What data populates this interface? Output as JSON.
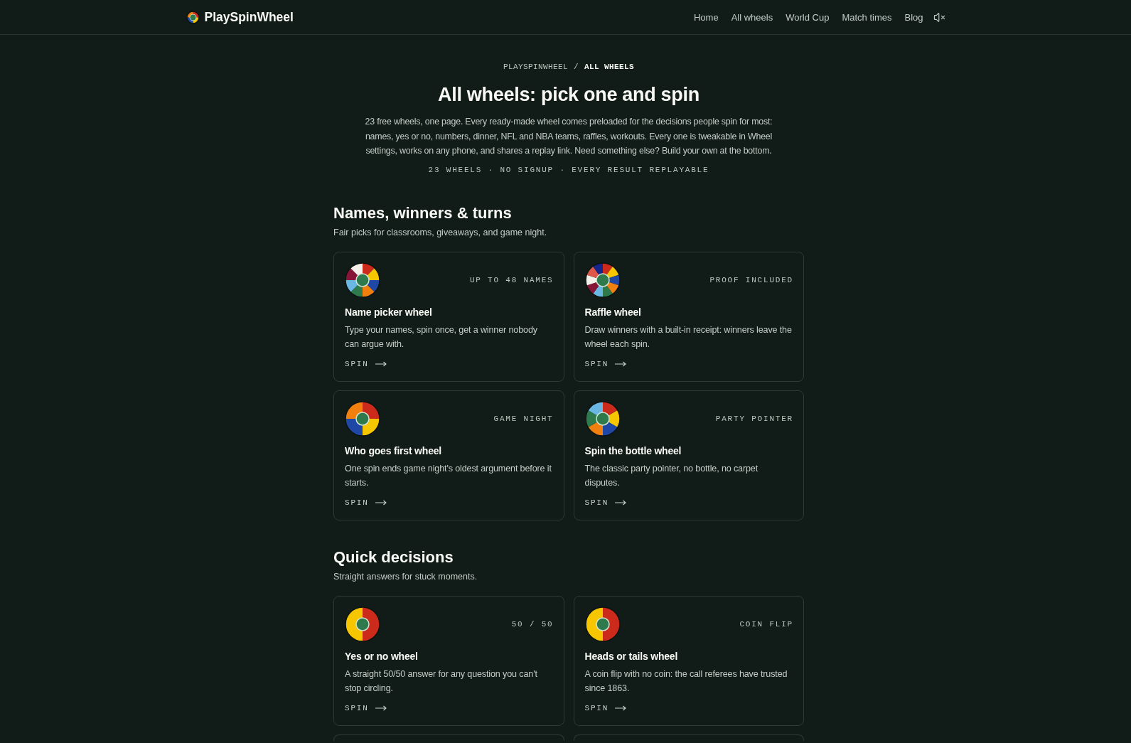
{
  "header": {
    "logo": "PlaySpinWheel",
    "nav": [
      "Home",
      "All wheels",
      "World Cup",
      "Match times",
      "Blog"
    ],
    "sound": {
      "muted": true
    }
  },
  "breadcrumb": {
    "separator": "/",
    "items": [
      {
        "label": "PLAYSPINWHEEL",
        "current": false
      },
      {
        "label": "ALL WHEELS",
        "current": true
      }
    ]
  },
  "title": "All wheels: pick one and spin",
  "intro": "23 free wheels, one page. Every ready-made wheel comes preloaded for the decisions people spin for most: names, yes or no, numbers, dinner, NFL and NBA teams, raffles, workouts. Every one is tweakable in Wheel settings, works on any phone, and shares a replay link. Need something else? Build your own at the bottom.",
  "tagline": "23 WHEELS · NO SIGNUP · EVERY RESULT REPLAYABLE",
  "sections": [
    {
      "heading": "Names, winners & turns",
      "subheading": "Fair picks for classrooms, giveaways, and game night.",
      "cards": [
        {
          "kind": "eight",
          "tag": "UP TO 48 NAMES",
          "title": "Name picker wheel",
          "description": "Type your names, spin once, get a winner nobody can argue with.",
          "action": "SPIN"
        },
        {
          "kind": "ten",
          "tag": "PROOF INCLUDED",
          "title": "Raffle wheel",
          "description": "Draw winners with a built-in receipt: winners leave the wheel each spin.",
          "action": "SPIN"
        },
        {
          "kind": "four",
          "tag": "GAME NIGHT",
          "title": "Who goes first wheel",
          "description": "One spin ends game night's oldest argument before it starts.",
          "action": "SPIN"
        },
        {
          "kind": "six",
          "tag": "PARTY POINTER",
          "title": "Spin the bottle wheel",
          "description": "The classic party pointer, no bottle, no carpet disputes.",
          "action": "SPIN"
        }
      ]
    },
    {
      "heading": "Quick decisions",
      "subheading": "Straight answers for stuck moments.",
      "cards": [
        {
          "kind": "two",
          "tag": "50 / 50",
          "title": "Yes or no wheel",
          "description": "A straight 50/50 answer for any question you can't stop circling.",
          "action": "SPIN"
        },
        {
          "kind": "two",
          "tag": "COIN FLIP",
          "title": "Heads or tails wheel",
          "description": "A coin flip with no coin: the call referees have trusted since 1863.",
          "action": "SPIN"
        },
        {
          "kind": "cut"
        },
        {
          "kind": "cut"
        }
      ]
    }
  ]
}
